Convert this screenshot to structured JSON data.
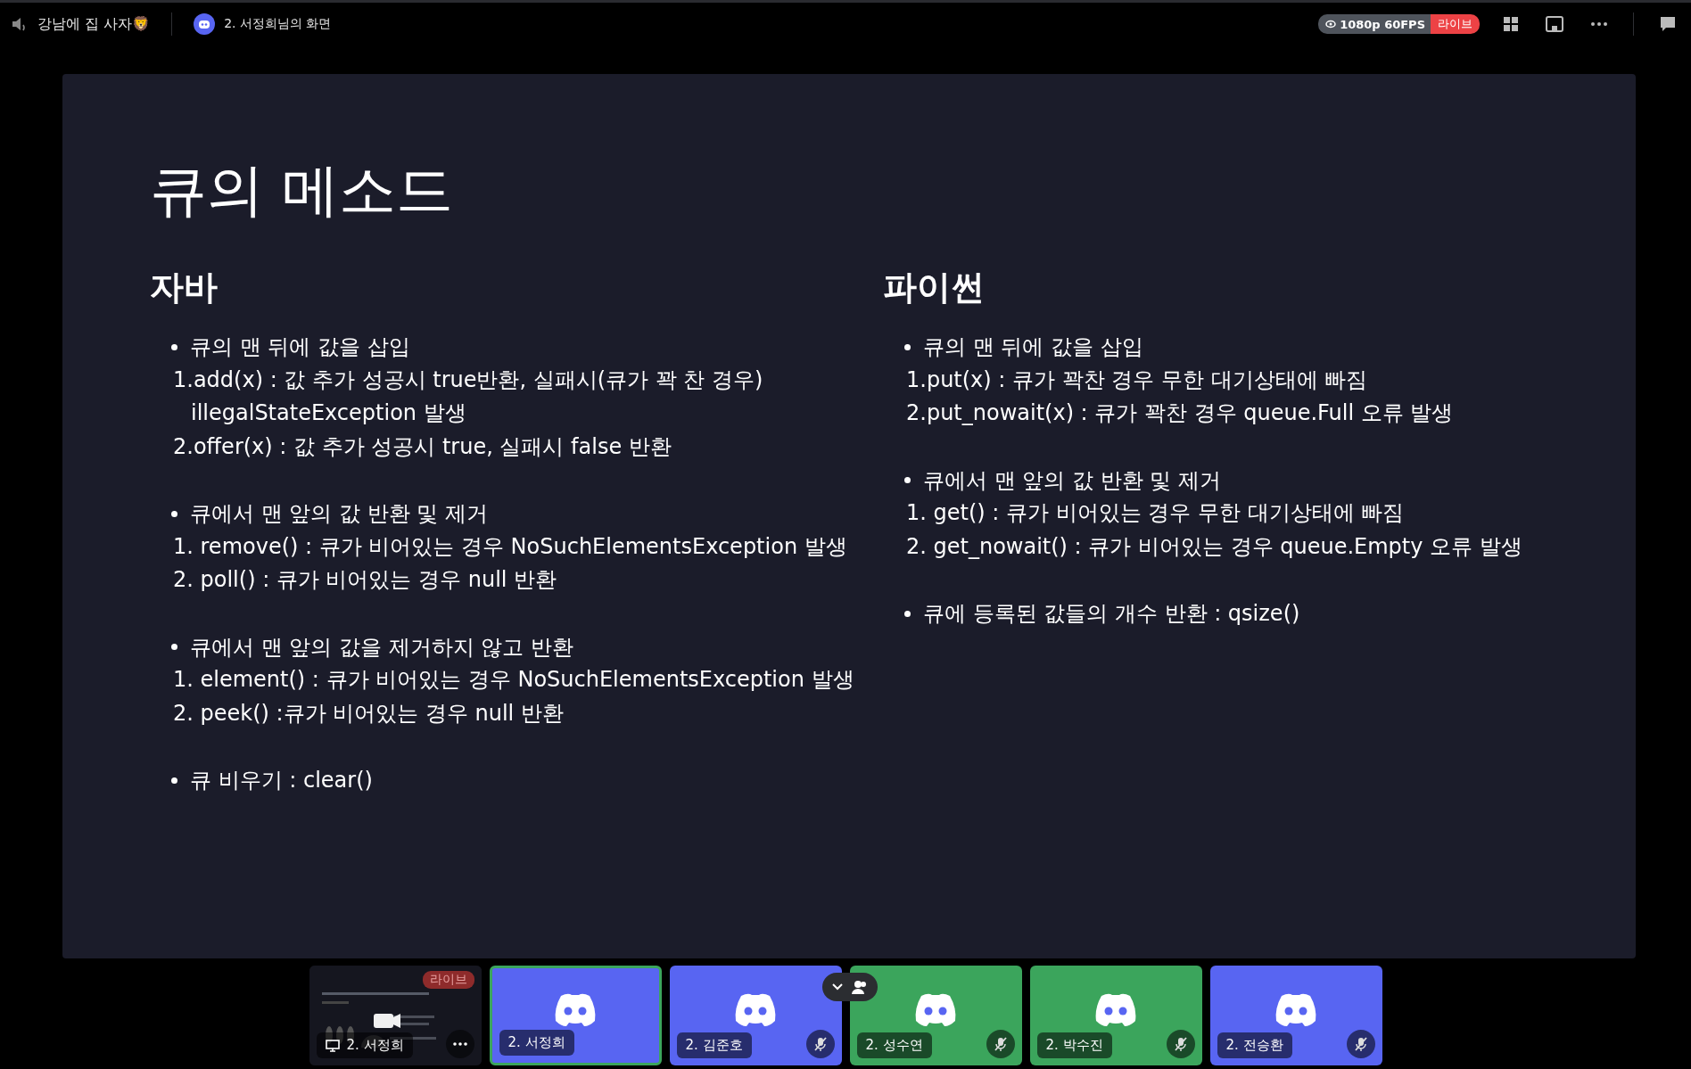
{
  "top_bar": {
    "channel": "강남에 집 사자🦁",
    "stream_title": "2. 서정희님의 화면",
    "quality": "1080p 60FPS",
    "live_badge": "라이브"
  },
  "slide": {
    "title": "큐의 메소드",
    "columns": [
      {
        "heading": "자바",
        "blocks": [
          {
            "bullet": "큐의 맨 뒤에 값을 삽입",
            "lines": [
              {
                "kind": "item",
                "text": "1.add(x) : 값 추가 성공시 true반환, 실패시(큐가 꽉 찬 경우)"
              },
              {
                "kind": "continuation",
                "text": "illegalStateException  발생"
              },
              {
                "kind": "item",
                "text": "2.offer(x) : 값 추가 성공시 true, 실패시 false 반환"
              }
            ]
          },
          {
            "bullet": "큐에서 맨 앞의 값 반환 및 제거",
            "lines": [
              {
                "kind": "item",
                "text": "1. remove() : 큐가 비어있는 경우 NoSuchElementsException 발생"
              },
              {
                "kind": "item",
                "text": "2. poll() : 큐가 비어있는 경우 null 반환"
              }
            ]
          },
          {
            "bullet": "큐에서 맨 앞의 값을 제거하지 않고 반환",
            "lines": [
              {
                "kind": "item",
                "text": "1. element() : 큐가 비어있는 경우 NoSuchElementsException 발생"
              },
              {
                "kind": "item",
                "text": "2. peek() :큐가 비어있는 경우 null 반환"
              }
            ]
          },
          {
            "bullet": "큐 비우기 : clear()"
          }
        ]
      },
      {
        "heading": "파이썬",
        "blocks": [
          {
            "bullet": "큐의 맨 뒤에 값을 삽입",
            "lines": [
              {
                "kind": "item",
                "text": "1.put(x) : 큐가 꽉찬 경우 무한 대기상태에 빠짐"
              },
              {
                "kind": "item",
                "text": "2.put_nowait(x) : 큐가 꽉찬 경우 queue.Full 오류 발생"
              }
            ]
          },
          {
            "bullet": "큐에서 맨 앞의 값 반환 및 제거",
            "lines": [
              {
                "kind": "item",
                "text": "1. get() : 큐가 비어있는 경우 무한 대기상태에  빠짐"
              },
              {
                "kind": "item",
                "text": "2. get_nowait() : 큐가 비어있는 경우 queue.Empty 오류 발생"
              }
            ]
          },
          {
            "bullet": "큐에 등록된 값들의 개수 반환 : qsize()"
          }
        ]
      }
    ]
  },
  "participants_panel": {
    "expanded": false
  },
  "tiles": [
    {
      "kind": "screen",
      "name": "2. 서정희",
      "live_badge": "라이브",
      "selected": false
    },
    {
      "kind": "avatar",
      "name": "2. 서정희",
      "color": "#5865f2",
      "selected": true,
      "muted": false
    },
    {
      "kind": "avatar",
      "name": "2. 김준호",
      "color": "#5865f2",
      "selected": false,
      "muted": true
    },
    {
      "kind": "avatar",
      "name": "2. 성수연",
      "color": "#3ba55c",
      "selected": false,
      "muted": true
    },
    {
      "kind": "avatar",
      "name": "2. 박수진",
      "color": "#3ba55c",
      "selected": false,
      "muted": true
    },
    {
      "kind": "avatar",
      "name": "2. 전승환",
      "color": "#5865f2",
      "selected": false,
      "muted": true
    }
  ]
}
